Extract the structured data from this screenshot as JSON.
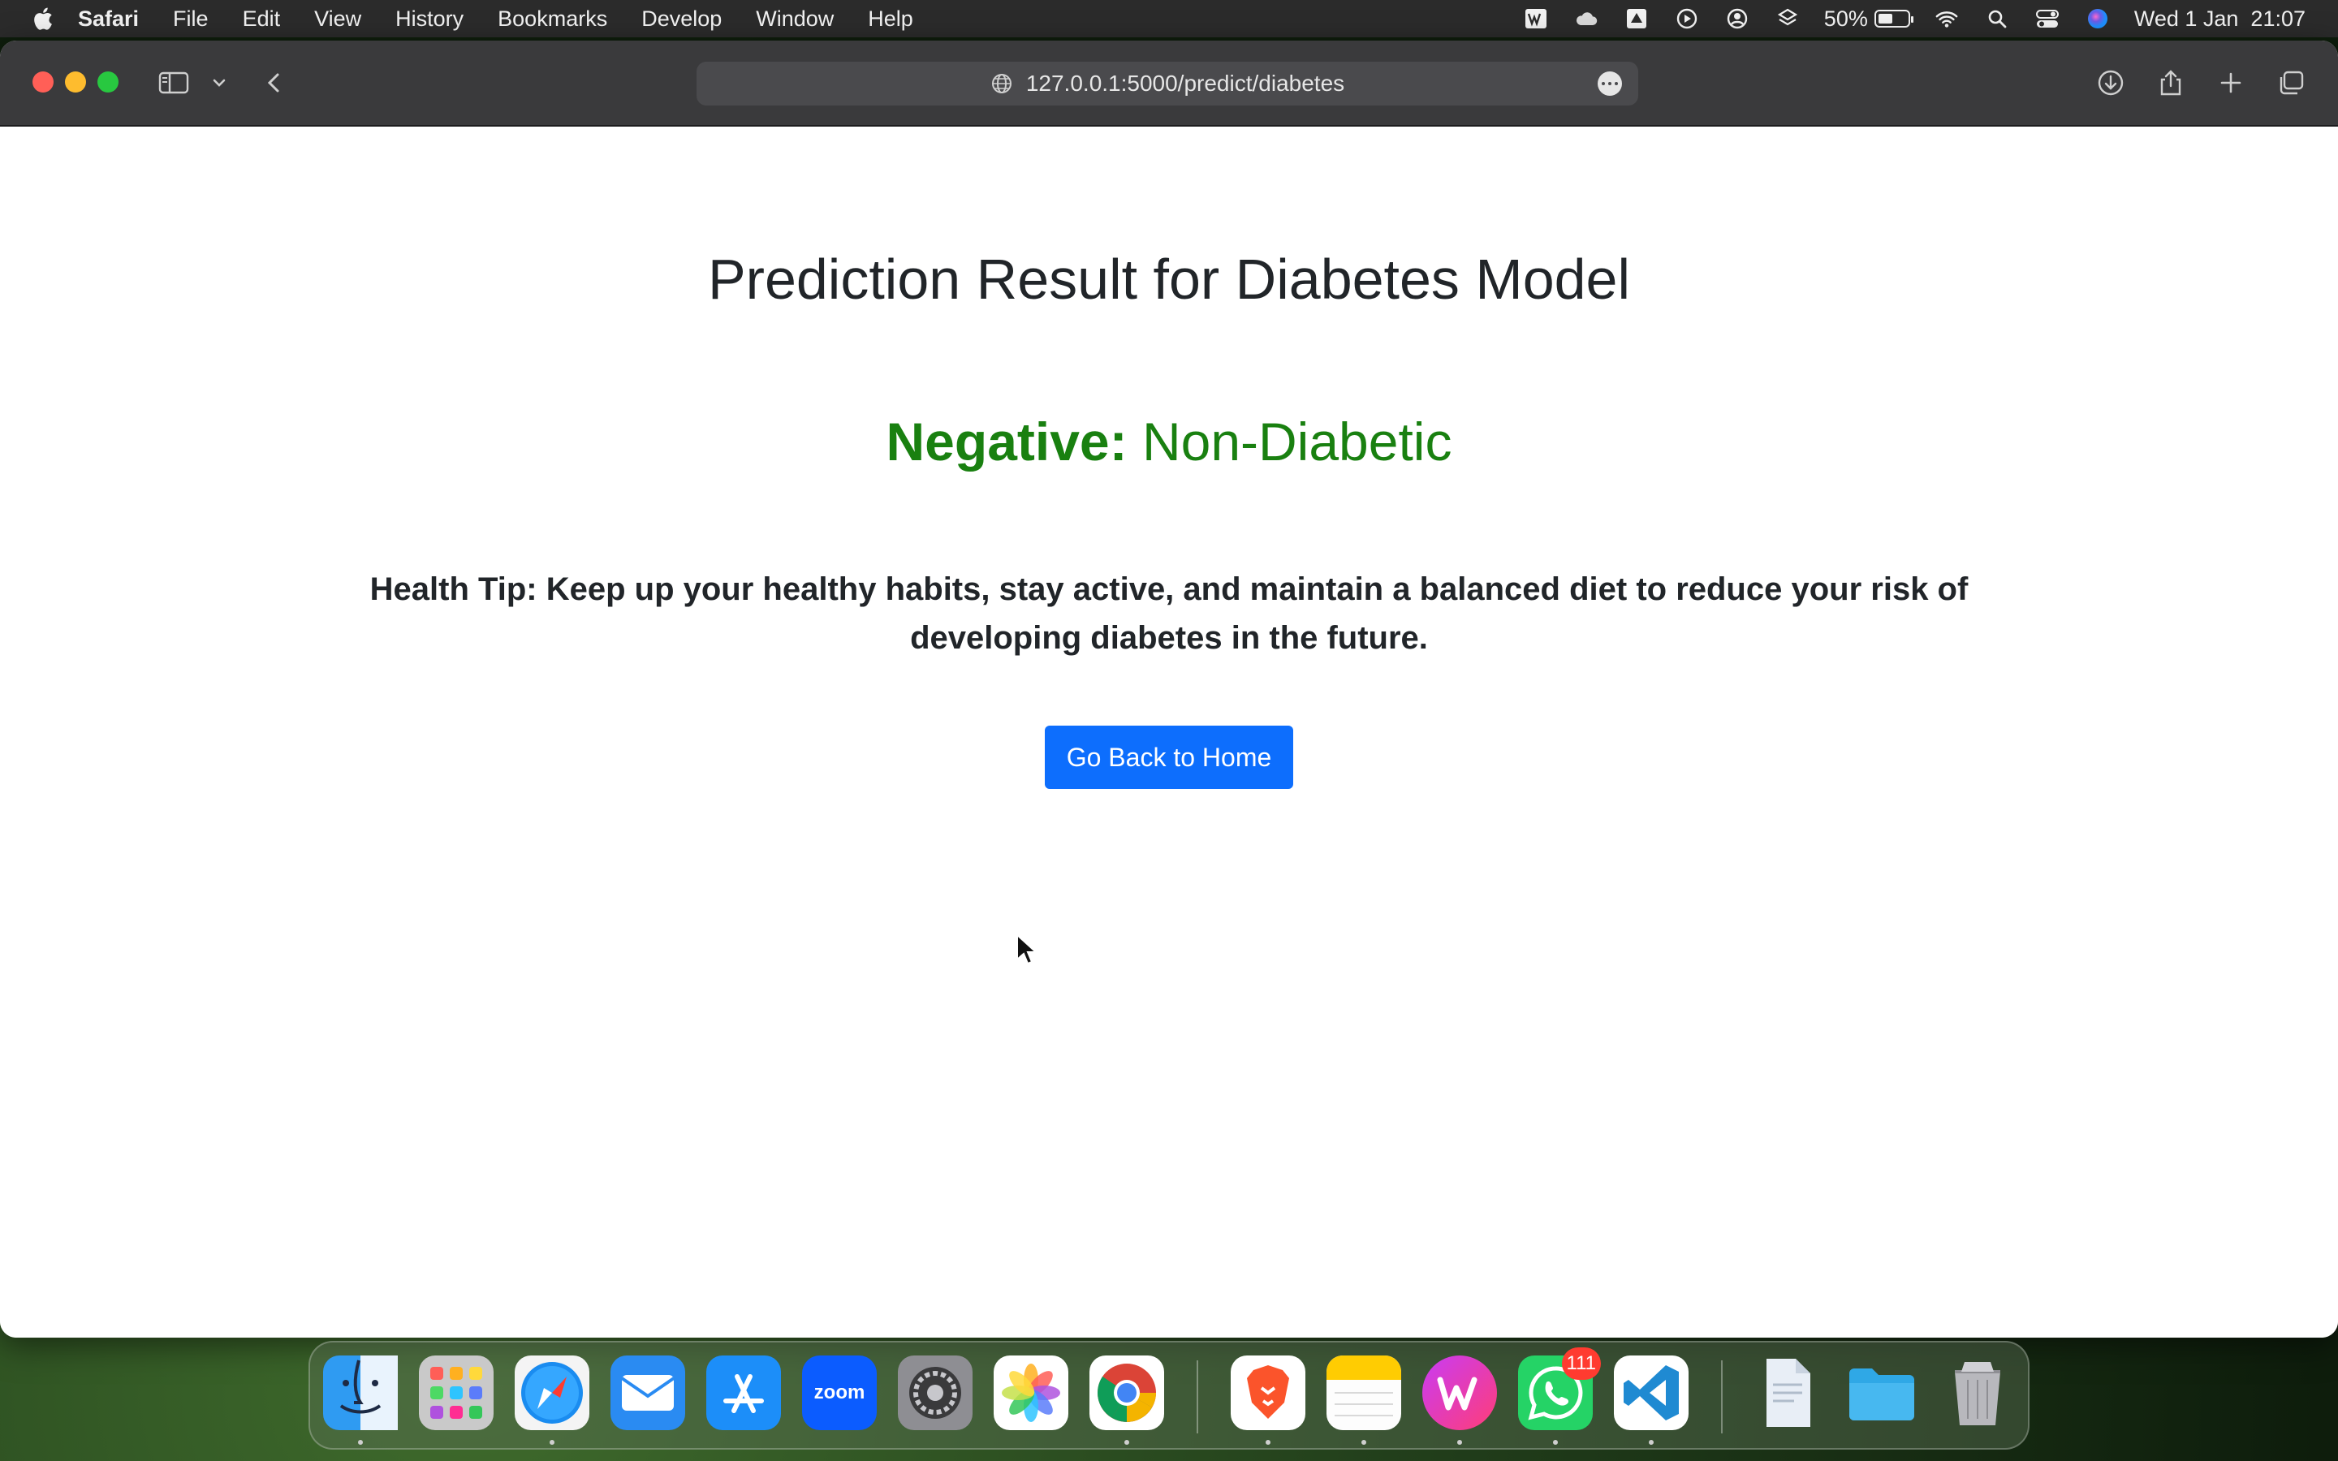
{
  "menubar": {
    "app_name": "Safari",
    "menus": [
      "File",
      "Edit",
      "View",
      "History",
      "Bookmarks",
      "Develop",
      "Window",
      "Help"
    ],
    "battery_percent": "50%",
    "battery_level": 0.5,
    "clock": "Wed 1 Jan  21:07"
  },
  "browser": {
    "url": "127.0.0.1:5000/predict/diabetes"
  },
  "page": {
    "title": "Prediction Result for Diabetes Model",
    "result_label": "Negative:",
    "result_value": " Non-Diabetic",
    "result_color": "#198010",
    "health_tip_label": "Health Tip:",
    "health_tip_text": " Keep up your healthy habits, stay active, and maintain a balanced diet to reduce your risk of developing diabetes in the future.",
    "home_button_label": "Go Back to Home",
    "button_color": "#0d6efd"
  },
  "dock": {
    "apps": [
      {
        "name": "Finder",
        "icon": "finder-icon",
        "running": true
      },
      {
        "name": "Launchpad",
        "icon": "launchpad-icon",
        "running": false
      },
      {
        "name": "Safari",
        "icon": "safari-icon",
        "running": true
      },
      {
        "name": "Mail",
        "icon": "mail-icon",
        "running": false
      },
      {
        "name": "App Store",
        "icon": "app-store-icon",
        "running": false
      },
      {
        "name": "Zoom",
        "icon": "zoom-icon",
        "running": false
      },
      {
        "name": "System Settings",
        "icon": "settings-icon",
        "running": false
      },
      {
        "name": "Photos",
        "icon": "photos-icon",
        "running": false
      },
      {
        "name": "Chrome",
        "icon": "chrome-icon",
        "running": true
      },
      {
        "name": "Brave",
        "icon": "brave-icon",
        "running": true
      },
      {
        "name": "Notes",
        "icon": "notes-icon",
        "running": true
      },
      {
        "name": "WPS Office",
        "icon": "wps-icon",
        "running": true
      },
      {
        "name": "WhatsApp",
        "icon": "whatsapp-icon",
        "running": true
      },
      {
        "name": "VS Code",
        "icon": "vscode-icon",
        "running": true
      },
      {
        "name": "Document",
        "icon": "document-icon",
        "running": false
      },
      {
        "name": "Folder",
        "icon": "folder-icon",
        "running": false
      },
      {
        "name": "Trash",
        "icon": "trash-icon",
        "running": false
      }
    ],
    "whatsapp_badge": "111"
  }
}
